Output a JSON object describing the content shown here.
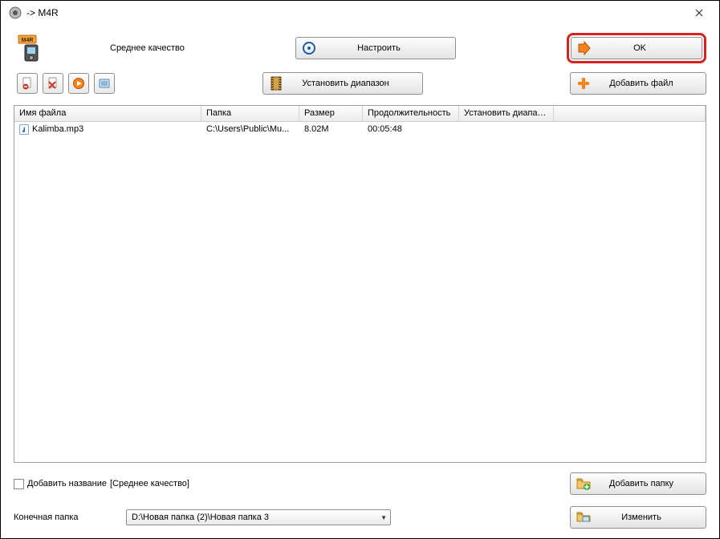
{
  "window": {
    "title": " -> M4R"
  },
  "top": {
    "format_code": "M4R",
    "quality_text": "Среднее качество",
    "settings_label": "Настроить",
    "ok_label": "OK"
  },
  "second": {
    "range_label": "Установить диапазон",
    "add_file_label": "Добавить файл"
  },
  "table": {
    "headers": {
      "name": "Имя файла",
      "folder": "Папка",
      "size": "Размер",
      "duration": "Продолжительность",
      "range": "Установить диапаз..."
    },
    "rows": [
      {
        "name": "Kalimba.mp3",
        "folder": "C:\\Users\\Public\\Mu...",
        "size": "8.02M",
        "duration": "00:05:48",
        "range": ""
      }
    ]
  },
  "bottom": {
    "add_title_label": "Добавить название",
    "add_title_suffix": "[Среднее качество]",
    "add_folder_label": "Добавить папку",
    "target_folder_label": "Конечная папка",
    "target_folder_value": "D:\\Новая папка (2)\\Новая папка 3",
    "change_label": "Изменить"
  }
}
